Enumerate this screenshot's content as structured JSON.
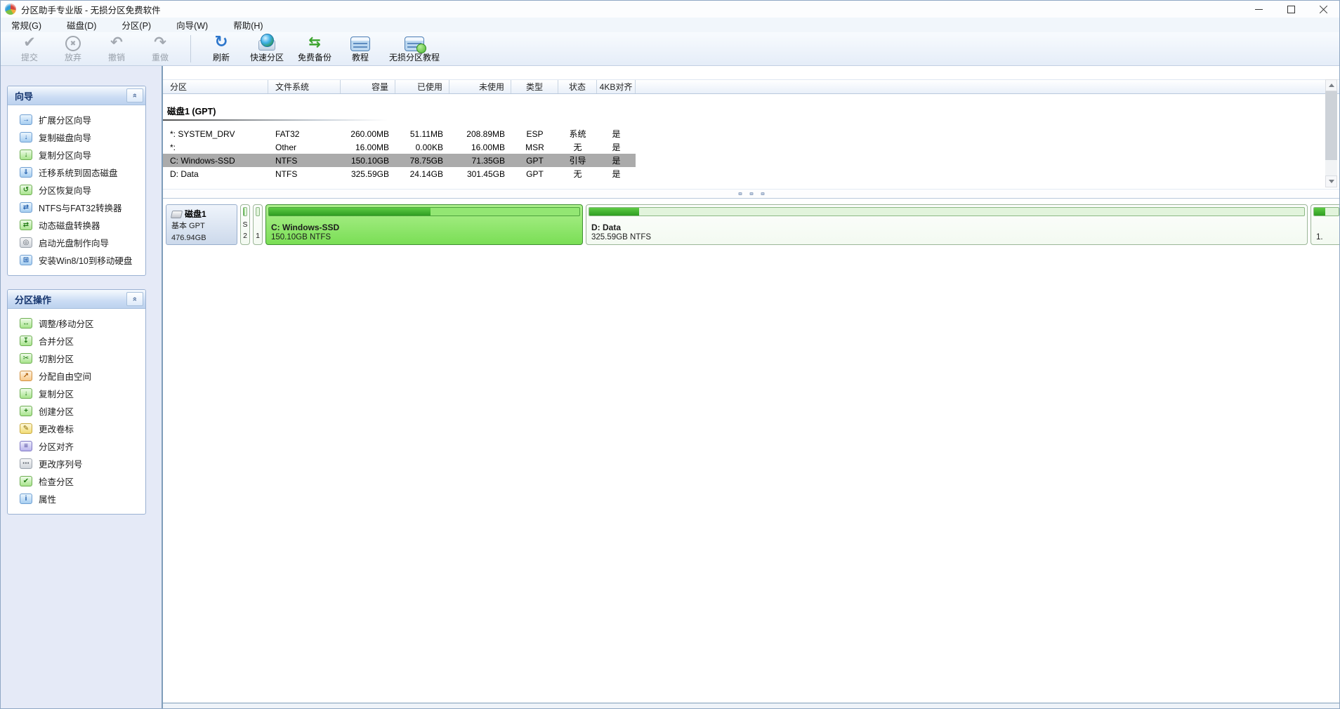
{
  "window": {
    "title": "分区助手专业版 - 无损分区免费软件"
  },
  "menubar": {
    "items": [
      {
        "name": "menu-general",
        "label": "常规(G)"
      },
      {
        "name": "menu-disk",
        "label": "磁盘(D)"
      },
      {
        "name": "menu-partition",
        "label": "分区(P)"
      },
      {
        "name": "menu-wizard",
        "label": "向导(W)"
      },
      {
        "name": "menu-help",
        "label": "帮助(H)"
      }
    ]
  },
  "toolbar": {
    "buttons": [
      {
        "name": "commit-button",
        "icon": "commit-icon",
        "label": "提交",
        "enabled": false
      },
      {
        "name": "discard-button",
        "icon": "discard-icon",
        "label": "放弃",
        "enabled": false
      },
      {
        "name": "undo-button",
        "icon": "undo-icon",
        "label": "撤销",
        "enabled": false
      },
      {
        "name": "redo-button",
        "icon": "redo-icon",
        "label": "重做",
        "enabled": false
      },
      {
        "type": "separator"
      },
      {
        "name": "refresh-button",
        "icon": "refresh-icon",
        "label": "刷新",
        "enabled": true
      },
      {
        "name": "quick-partition-button",
        "icon": "quick-partition-icon",
        "label": "快速分区",
        "enabled": true
      },
      {
        "name": "free-backup-button",
        "icon": "free-backup-icon",
        "label": "免费备份",
        "enabled": true
      },
      {
        "name": "tutorial-button",
        "icon": "tutorial-icon",
        "label": "教程",
        "enabled": true
      },
      {
        "name": "lossless-tutorial-button",
        "icon": "lossless-tutorial-icon",
        "label": "无损分区教程",
        "enabled": true
      }
    ]
  },
  "sidebar": {
    "panels": [
      {
        "name": "wizards-panel",
        "title": "向导",
        "items": [
          {
            "name": "wizard-extend-partition",
            "icon": "extend-partition-icon",
            "label": "扩展分区向导"
          },
          {
            "name": "wizard-clone-disk",
            "icon": "clone-disk-icon",
            "label": "复制磁盘向导"
          },
          {
            "name": "wizard-clone-partition",
            "icon": "clone-partition-icon",
            "label": "复制分区向导"
          },
          {
            "name": "wizard-migrate-os-to-ssd",
            "icon": "migrate-ssd-icon",
            "label": "迁移系统到固态磁盘"
          },
          {
            "name": "wizard-partition-recovery",
            "icon": "partition-recovery-icon",
            "label": "分区恢复向导"
          },
          {
            "name": "wizard-ntfs-fat32-converter",
            "icon": "ntfs-fat32-icon",
            "label": "NTFS与FAT32转换器"
          },
          {
            "name": "wizard-dynamic-disk-converter",
            "icon": "dynamic-disk-icon",
            "label": "动态磁盘转换器"
          },
          {
            "name": "wizard-bootable-cd",
            "icon": "bootable-cd-icon",
            "label": "启动光盘制作向导"
          },
          {
            "name": "wizard-install-win-to-usb",
            "icon": "win-usb-icon",
            "label": "安装Win8/10到移动硬盘"
          }
        ]
      },
      {
        "name": "partition-operations-panel",
        "title": "分区操作",
        "items": [
          {
            "name": "op-resize-move-partition",
            "icon": "resize-move-icon",
            "label": "调整/移动分区"
          },
          {
            "name": "op-merge-partitions",
            "icon": "merge-partition-icon",
            "label": "合并分区"
          },
          {
            "name": "op-split-partition",
            "icon": "split-partition-icon",
            "label": "切割分区"
          },
          {
            "name": "op-allocate-free-space",
            "icon": "allocate-space-icon",
            "label": "分配自由空间"
          },
          {
            "name": "op-copy-partition",
            "icon": "copy-partition-icon",
            "label": "复制分区"
          },
          {
            "name": "op-create-partition",
            "icon": "create-partition-icon",
            "label": "创建分区"
          },
          {
            "name": "op-change-label",
            "icon": "change-label-icon",
            "label": "更改卷标"
          },
          {
            "name": "op-partition-alignment",
            "icon": "partition-align-icon",
            "label": "分区对齐"
          },
          {
            "name": "op-change-serial-number",
            "icon": "change-serial-icon",
            "label": "更改序列号"
          },
          {
            "name": "op-check-partition",
            "icon": "check-partition-icon",
            "label": "检查分区"
          },
          {
            "name": "op-properties",
            "icon": "properties-icon",
            "label": "属性"
          }
        ]
      }
    ]
  },
  "table": {
    "columns": [
      {
        "name": "col-partition",
        "label": "分区"
      },
      {
        "name": "col-filesystem",
        "label": "文件系统"
      },
      {
        "name": "col-capacity",
        "label": "容量"
      },
      {
        "name": "col-used",
        "label": "已使用"
      },
      {
        "name": "col-unused",
        "label": "未使用"
      },
      {
        "name": "col-type",
        "label": "类型"
      },
      {
        "name": "col-status",
        "label": "状态"
      },
      {
        "name": "col-4k-aligned",
        "label": "4KB对齐"
      }
    ],
    "group_title": "磁盘1 (GPT)",
    "rows": [
      {
        "name": "row-system-drv",
        "selected": false,
        "cells": [
          "*: SYSTEM_DRV",
          "FAT32",
          "260.00MB",
          "51.11MB",
          "208.89MB",
          "ESP",
          "系统",
          "是"
        ]
      },
      {
        "name": "row-msr",
        "selected": false,
        "cells": [
          "*:",
          "Other",
          "16.00MB",
          "0.00KB",
          "16.00MB",
          "MSR",
          "无",
          "是"
        ]
      },
      {
        "name": "row-c-windows-ssd",
        "selected": true,
        "cells": [
          "C: Windows-SSD",
          "NTFS",
          "150.10GB",
          "78.75GB",
          "71.35GB",
          "GPT",
          "引导",
          "是"
        ]
      },
      {
        "name": "row-d-data",
        "selected": false,
        "cells": [
          "D: Data",
          "NTFS",
          "325.59GB",
          "24.14GB",
          "301.45GB",
          "GPT",
          "无",
          "是"
        ]
      }
    ]
  },
  "disk_map": {
    "disk": {
      "name": "磁盘1",
      "type": "基本 GPT",
      "size": "476.94GB"
    },
    "partitions": [
      {
        "name": "partition-block-system-drv",
        "kind": "small",
        "selected": false,
        "line1": "S",
        "line2": "2",
        "used_pct": 20
      },
      {
        "name": "partition-block-msr",
        "kind": "small",
        "selected": false,
        "line1": "",
        "line2": "1",
        "used_pct": 0
      },
      {
        "name": "partition-block-c",
        "kind": "normal",
        "selected": true,
        "title": "C: Windows-SSD",
        "info": "150.10GB NTFS",
        "used_pct": 52
      },
      {
        "name": "partition-block-d",
        "kind": "normal",
        "selected": false,
        "title": "D: Data",
        "info": "325.59GB NTFS",
        "used_pct": 7
      },
      {
        "name": "partition-block-edge",
        "kind": "partial",
        "selected": false,
        "title": "",
        "info": "1.",
        "used_pct": 45
      }
    ]
  },
  "colors": {
    "used_green": "#2f9e22",
    "partition_selected_green": "#7ade55",
    "selected_row_gray": "#ababab",
    "panel_header_text": "#15356e"
  }
}
